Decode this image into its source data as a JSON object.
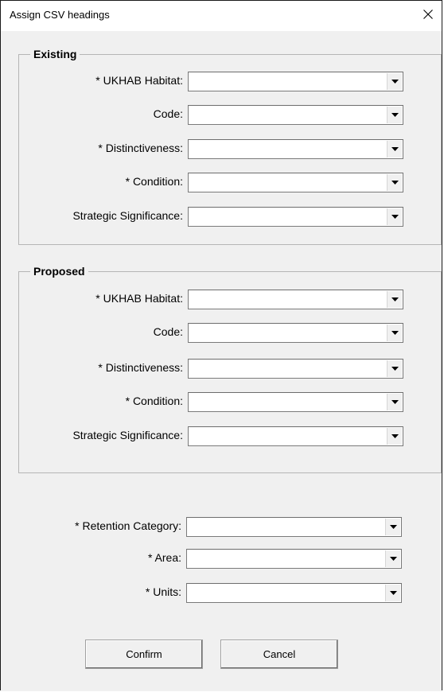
{
  "window": {
    "title": "Assign CSV headings",
    "close_icon": "close-icon"
  },
  "existing": {
    "legend": "Existing",
    "fields": [
      {
        "label": "* UKHAB Habitat:",
        "value": ""
      },
      {
        "label": "Code:",
        "value": ""
      },
      {
        "label": "* Distinctiveness:",
        "value": ""
      },
      {
        "label": "* Condition:",
        "value": ""
      },
      {
        "label": "Strategic Significance:",
        "value": ""
      }
    ]
  },
  "proposed": {
    "legend": "Proposed",
    "fields": [
      {
        "label": "* UKHAB Habitat:",
        "value": ""
      },
      {
        "label": "Code:",
        "value": ""
      },
      {
        "label": "* Distinctiveness:",
        "value": ""
      },
      {
        "label": "* Condition:",
        "value": ""
      },
      {
        "label": "Strategic Significance:",
        "value": ""
      }
    ]
  },
  "extra": {
    "fields": [
      {
        "label": "* Retention Category:",
        "value": ""
      },
      {
        "label": "* Area:",
        "value": ""
      },
      {
        "label": "* Units:",
        "value": ""
      }
    ]
  },
  "buttons": {
    "confirm": "Confirm",
    "cancel": "Cancel"
  },
  "colors": {
    "dialog_bg": "#f0f0f0",
    "titlebar_bg": "#ffffff",
    "frame_border": "#b5b5b5",
    "combo_border": "#7a7a7a"
  }
}
